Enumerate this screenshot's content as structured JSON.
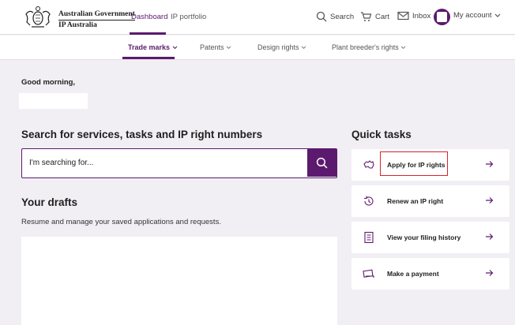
{
  "header": {
    "gov_line1": "Australian Government",
    "gov_line2": "IP Australia",
    "tabs": [
      {
        "label": "Dashboard",
        "active": true
      },
      {
        "label": "IP portfolio",
        "active": false
      }
    ],
    "search_label": "Search",
    "cart_label": "Cart",
    "inbox_label": "Inbox",
    "account_label": "My account",
    "accent_color": "#5c1a6e"
  },
  "subnav": {
    "items": [
      {
        "label": "Trade marks",
        "active": true
      },
      {
        "label": "Patents",
        "active": false
      },
      {
        "label": "Design rights",
        "active": false
      },
      {
        "label": "Plant breeder's rights",
        "active": false
      }
    ]
  },
  "main": {
    "greeting": "Good morning,",
    "search_heading": "Search for services, tasks and IP right numbers",
    "search_placeholder": "I'm searching for...",
    "drafts_heading": "Your drafts",
    "drafts_description": "Resume and manage your saved applications and requests."
  },
  "quick_tasks": {
    "heading": "Quick tasks",
    "items": [
      {
        "label": "Apply for IP rights",
        "icon": "australia-map-icon",
        "highlighted": true
      },
      {
        "label": "Renew an IP right",
        "icon": "renew-clock-icon",
        "highlighted": false
      },
      {
        "label": "View your filing history",
        "icon": "document-list-icon",
        "highlighted": false
      },
      {
        "label": "Make a payment",
        "icon": "payment-card-icon",
        "highlighted": false
      }
    ],
    "highlight_color": "#d8232a"
  }
}
